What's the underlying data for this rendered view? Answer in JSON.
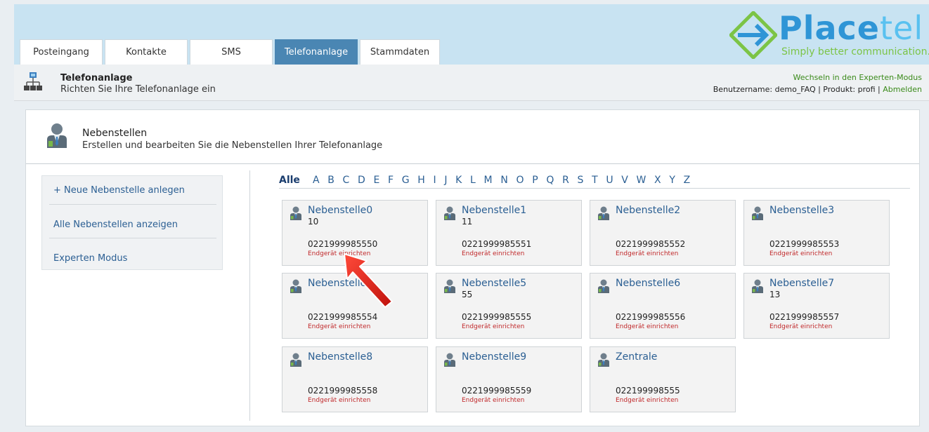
{
  "header": {
    "tabs": [
      "Posteingang",
      "Kontakte",
      "SMS",
      "Telefonanlage",
      "Stammdaten"
    ],
    "active_tab": "Telefonanlage",
    "logo_text_place": "Place",
    "logo_text_tel": "tel",
    "tagline": "Simply better communication."
  },
  "subheader": {
    "title": "Telefonanlage",
    "description": "Richten Sie Ihre Telefonanlage ein",
    "expert_mode": "Wechseln in den Experten-Modus",
    "user_prefix": "Benutzername: demo_FAQ | Produkt: profi | ",
    "logout": "Abmelden"
  },
  "section": {
    "title": "Nebenstellen",
    "description": "Erstellen und bearbeiten Sie die Nebenstellen Ihrer Telefonanlage"
  },
  "sidebar": {
    "items": [
      "+ Neue Nebenstelle anlegen",
      "Alle Nebenstellen anzeigen",
      "Experten Modus"
    ]
  },
  "alphabet": {
    "all": "Alle",
    "letters": [
      "A",
      "B",
      "C",
      "D",
      "E",
      "F",
      "G",
      "H",
      "I",
      "J",
      "K",
      "L",
      "M",
      "N",
      "O",
      "P",
      "Q",
      "R",
      "S",
      "T",
      "U",
      "V",
      "W",
      "X",
      "Y",
      "Z"
    ]
  },
  "cards": [
    {
      "name": "Nebenstelle0",
      "ext": "10",
      "number": "0221999985550",
      "link": "Endgerät einrichten"
    },
    {
      "name": "Nebenstelle1",
      "ext": "11",
      "number": "0221999985551",
      "link": "Endgerät einrichten"
    },
    {
      "name": "Nebenstelle2",
      "ext": "",
      "number": "0221999985552",
      "link": "Endgerät einrichten"
    },
    {
      "name": "Nebenstelle3",
      "ext": "",
      "number": "0221999985553",
      "link": "Endgerät einrichten"
    },
    {
      "name": "Nebenstelle",
      "ext": "",
      "number": "0221999985554",
      "link": "Endgerät einrichten"
    },
    {
      "name": "Nebenstelle5",
      "ext": "55",
      "number": "0221999985555",
      "link": "Endgerät einrichten"
    },
    {
      "name": "Nebenstelle6",
      "ext": "",
      "number": "0221999985556",
      "link": "Endgerät einrichten"
    },
    {
      "name": "Nebenstelle7",
      "ext": "13",
      "number": "0221999985557",
      "link": "Endgerät einrichten"
    },
    {
      "name": "Nebenstelle8",
      "ext": "",
      "number": "0221999985558",
      "link": "Endgerät einrichten"
    },
    {
      "name": "Nebenstelle9",
      "ext": "",
      "number": "0221999985559",
      "link": "Endgerät einrichten"
    },
    {
      "name": "Zentrale",
      "ext": "",
      "number": "022199998555",
      "link": "Endgerät einrichten"
    }
  ],
  "colors": {
    "accent": "#4a86b3",
    "link": "#2b5f93",
    "warning_link": "#c0282a",
    "green_link": "#3a8a1a",
    "header_bg": "#c8e3f2"
  }
}
